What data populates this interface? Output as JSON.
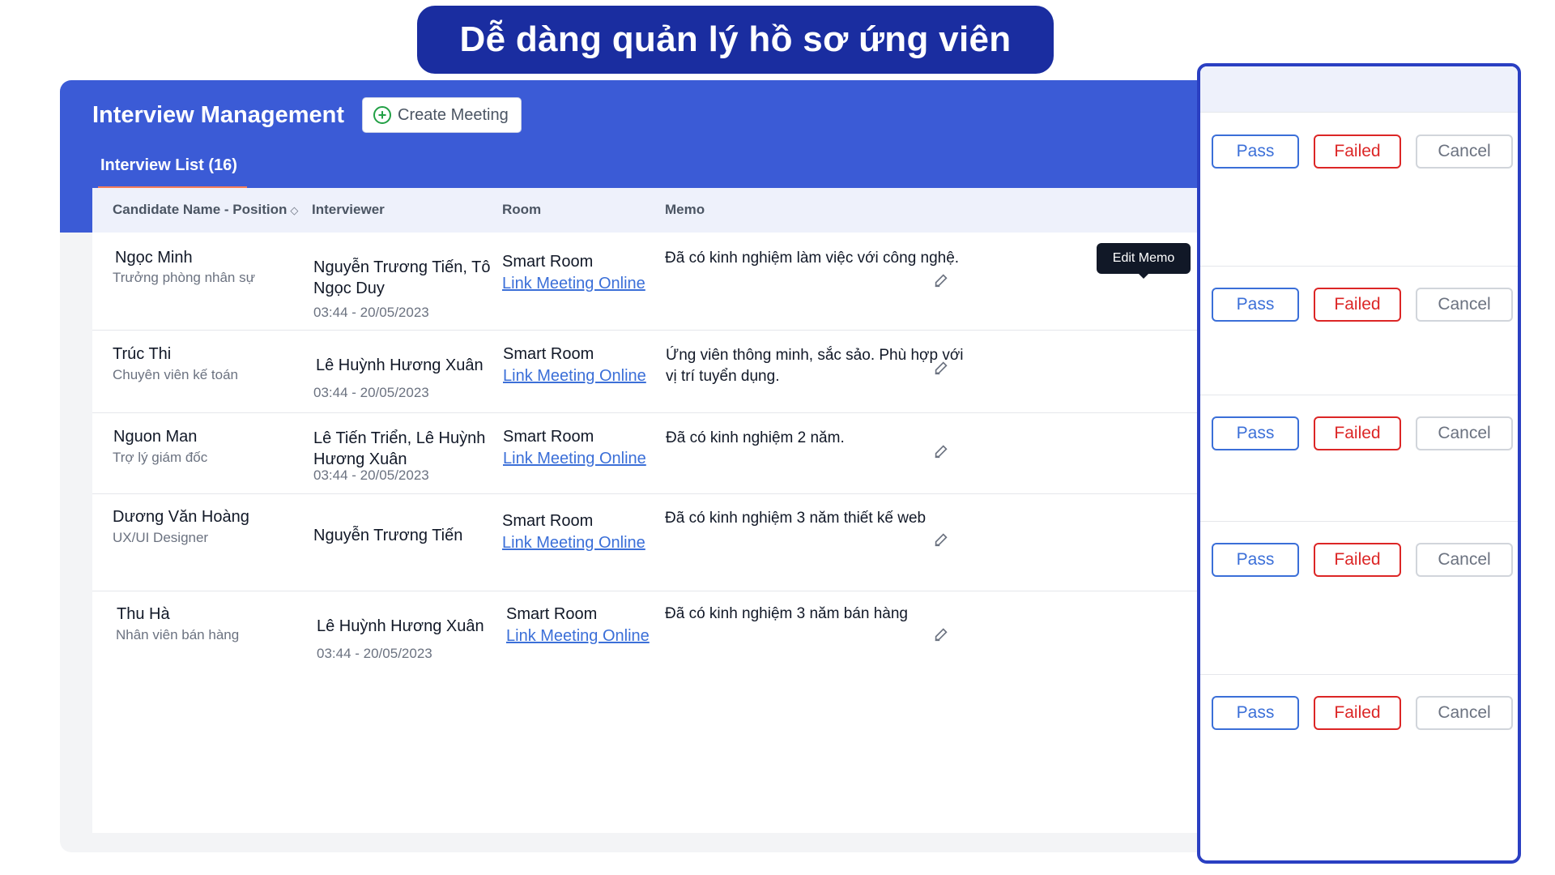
{
  "banner": {
    "text": "Dễ dàng quản lý hồ sơ ứng viên"
  },
  "app": {
    "title": "Interview Management",
    "create_button": "Create Meeting",
    "tab": "Interview List (16)"
  },
  "table": {
    "headers": {
      "candidate": "Candidate Name - Position",
      "interviewer": "Interviewer",
      "room": "Room",
      "memo": "Memo"
    },
    "rows": [
      {
        "name": "Ngọc Minh",
        "position": "Trưởng phòng nhân sự",
        "interviewer": "Nguyễn Trương Tiến, Tô Ngọc Duy",
        "time": "03:44 - 20/05/2023",
        "room": "Smart Room",
        "link": "Link Meeting Online",
        "memo": "Đã có kinh nghiệm làm việc với công nghệ."
      },
      {
        "name": "Trúc Thi",
        "position": "Chuyên viên kế toán",
        "interviewer": "Lê Huỳnh Hương Xuân",
        "time": "03:44 - 20/05/2023",
        "room": "Smart Room",
        "link": "Link Meeting Online",
        "memo": "Ứng viên thông minh, sắc sảo. Phù hợp với vị trí tuyển dụng."
      },
      {
        "name": "Nguon Man",
        "position": "Trợ lý giám đốc",
        "interviewer": "Lê Tiến Triển, Lê Huỳnh Hương Xuân",
        "time": "03:44 - 20/05/2023",
        "room": "Smart Room",
        "link": "Link Meeting Online",
        "memo": "Đã có kinh nghiệm 2 năm."
      },
      {
        "name": "Dương Văn Hoàng",
        "position": "UX/UI Designer",
        "interviewer": "Nguyễn Trương Tiến",
        "time": "",
        "room": "Smart Room",
        "link": "Link Meeting Online",
        "memo": "Đã có kinh nghiệm 3 năm thiết kế web"
      },
      {
        "name": "Thu Hà",
        "position": "Nhân viên bán hàng",
        "interviewer": "Lê Huỳnh Hương Xuân",
        "time": "03:44 - 20/05/2023",
        "room": "Smart Room",
        "link": "Link Meeting Online",
        "memo": "Đã có kinh nghiệm 3 năm bán hàng"
      }
    ]
  },
  "tooltip": "Edit Memo",
  "actions": {
    "pass": "Pass",
    "failed": "Failed",
    "cancel": "Cancel"
  },
  "colors": {
    "primary": "#3b5bd6",
    "banner": "#1a2da0",
    "pass": "#3b6fd8",
    "failed": "#dc2626",
    "tab_underline": "#f47c5a"
  },
  "icons": {
    "create": "plus-circle-icon",
    "edit": "pencil-icon",
    "sort": "sort-icon"
  }
}
